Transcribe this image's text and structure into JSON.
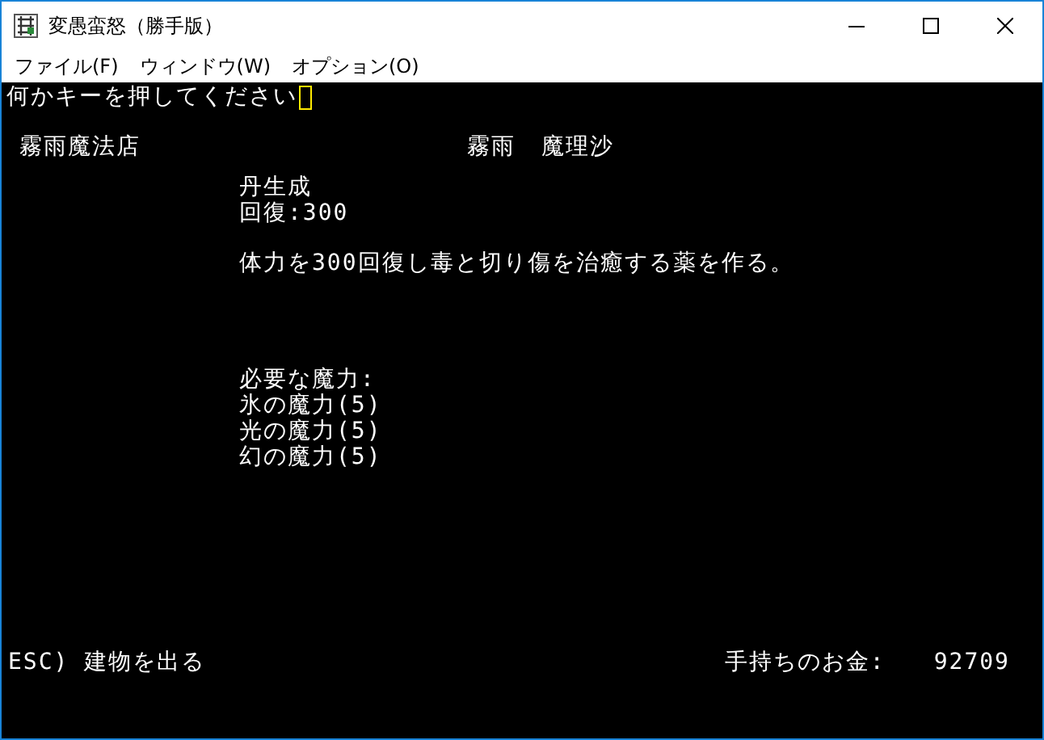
{
  "window": {
    "title": "変愚蛮怒（勝手版）"
  },
  "menu": [
    "ファイル(F)",
    "ウィンドウ(W)",
    "オプション(O)"
  ],
  "console": {
    "prompt": "何かキーを押してください",
    "shop_name": "霧雨魔法店",
    "owner_surname": "霧雨",
    "owner_name": "魔理沙",
    "item_name": "丹生成",
    "item_stat": "回復:300",
    "description": "体力を300回復し毒と切り傷を治癒する薬を作る。",
    "requirements_label": "必要な魔力:",
    "requirements": [
      "氷の魔力(5)",
      "光の魔力(5)",
      "幻の魔力(5)"
    ],
    "exit_hint": "ESC) 建物を出る",
    "money_label": "手持ちのお金:",
    "money_value": "92709"
  }
}
